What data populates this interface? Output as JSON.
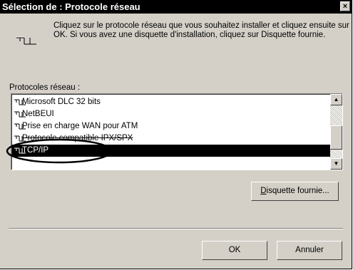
{
  "dialog": {
    "title": "Sélection de : Protocole réseau",
    "close_label": "×",
    "instructions": "Cliquez sur le protocole réseau que vous souhaitez installer et cliquez ensuite sur OK. Si vous avez une disquette d'installation, cliquez sur Disquette fournie."
  },
  "protocols": {
    "label": "Protocoles réseau :",
    "items": [
      {
        "label": "Microsoft DLC 32 bits",
        "icon": "network-protocol-icon"
      },
      {
        "label": "NetBEUI",
        "icon": "network-protocol-icon"
      },
      {
        "label": "Prise en charge WAN pour ATM",
        "icon": "network-protocol-icon"
      },
      {
        "label": "Protocole compatible IPX/SPX",
        "icon": "network-protocol-icon"
      },
      {
        "label": "TCP/IP",
        "icon": "network-protocol-icon",
        "selected": true
      }
    ]
  },
  "scrollbar": {
    "up": "▲",
    "down": "▼"
  },
  "buttons": {
    "disk_prefix": "D",
    "disk_rest": "isquette fournie...",
    "ok": "OK",
    "cancel": "Annuler"
  },
  "colors": {
    "dialog_bg": "#d4d0c8",
    "title_bg": "#000000",
    "selection_bg": "#000000"
  }
}
